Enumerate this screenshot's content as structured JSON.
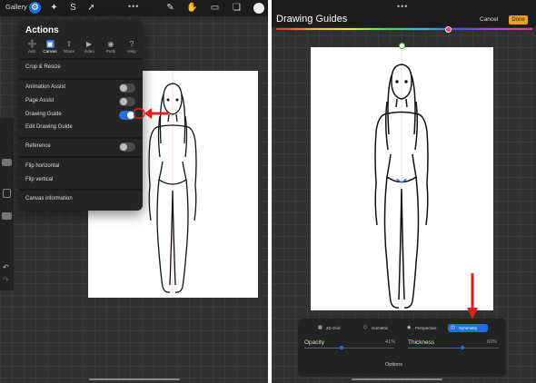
{
  "left": {
    "gallery_label": "Gallery",
    "actions": {
      "title": "Actions",
      "tabs": [
        {
          "label": "Add",
          "icon": "plus-icon"
        },
        {
          "label": "Canvas",
          "icon": "canvas-icon"
        },
        {
          "label": "Share",
          "icon": "share-icon"
        },
        {
          "label": "Video",
          "icon": "play-icon"
        },
        {
          "label": "Prefs",
          "icon": "toggle-icon"
        },
        {
          "label": "Help",
          "icon": "help-icon"
        }
      ],
      "active_tab": "Canvas",
      "crop": "Crop & Resize",
      "animation_assist": "Animation Assist",
      "page_assist": "Page Assist",
      "drawing_guide": "Drawing Guide",
      "edit_drawing_guide": "Edit Drawing Guide",
      "reference": "Reference",
      "flip_horizontal": "Flip horizontal",
      "flip_vertical": "Flip vertical",
      "canvas_information": "Canvas information",
      "toggles": {
        "animation_assist": false,
        "page_assist": false,
        "drawing_guide": true,
        "reference": false
      }
    }
  },
  "right": {
    "title": "Drawing Guides",
    "cancel": "Cancel",
    "done": "Done",
    "guide_tabs": [
      {
        "label": "2D Grid",
        "icon": "grid-icon"
      },
      {
        "label": "Isometric",
        "icon": "isometric-icon"
      },
      {
        "label": "Perspective",
        "icon": "perspective-icon"
      },
      {
        "label": "Symmetry",
        "icon": "symmetry-icon"
      }
    ],
    "active_guide_tab": "Symmetry",
    "opacity_label": "Opacity",
    "opacity_value": "41%",
    "thickness_label": "Thickness",
    "thickness_value": "60%",
    "opacity_level": 0.41,
    "thickness_level": 0.6,
    "options_label": "Options"
  },
  "colors": {
    "accent": "#1f6fe0",
    "done": "#f0a020",
    "annotation_arrow": "#e02020"
  }
}
